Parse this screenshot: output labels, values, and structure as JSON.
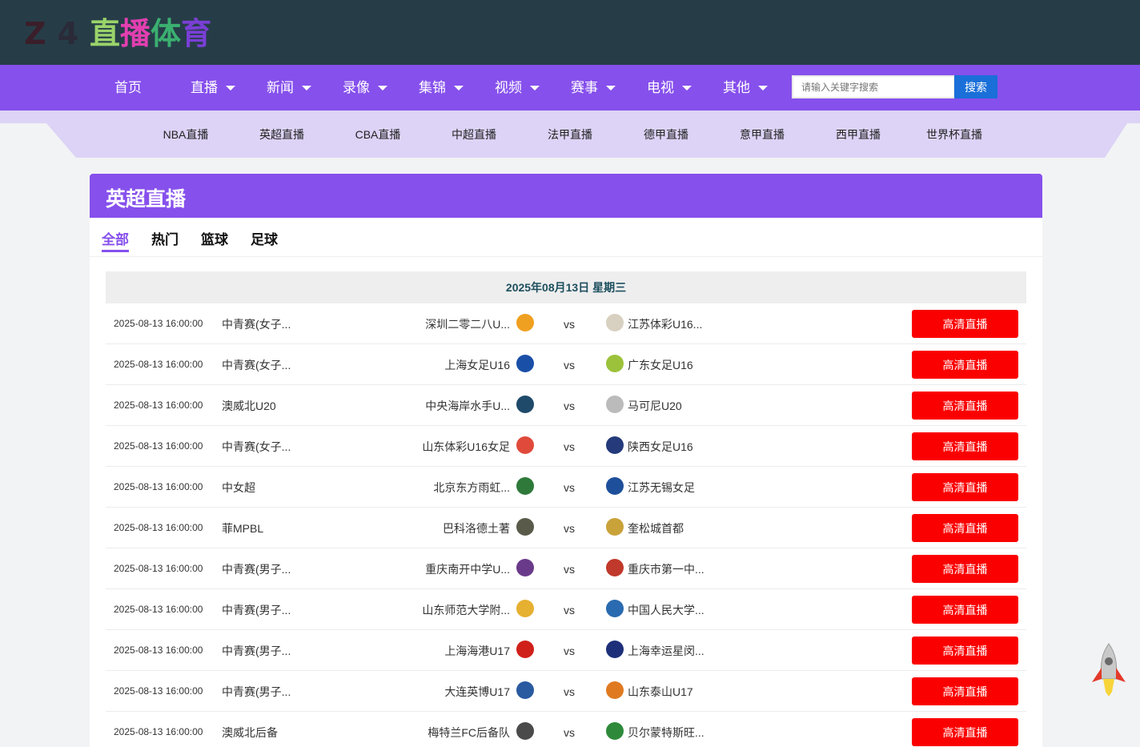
{
  "logo": {
    "chars": [
      "Z",
      "4",
      "直",
      "播",
      "体",
      "育"
    ],
    "colors": [
      "#3a1e2a",
      "#2a2a38",
      "#9ad36a",
      "#e23fb0",
      "#3bb070",
      "#7a3fd6"
    ]
  },
  "nav": {
    "items": [
      {
        "label": "首页",
        "dropdown": false
      },
      {
        "label": "直播",
        "dropdown": true
      },
      {
        "label": "新闻",
        "dropdown": true
      },
      {
        "label": "录像",
        "dropdown": true
      },
      {
        "label": "集锦",
        "dropdown": true
      },
      {
        "label": "视频",
        "dropdown": true
      },
      {
        "label": "赛事",
        "dropdown": true
      },
      {
        "label": "电视",
        "dropdown": true
      },
      {
        "label": "其他",
        "dropdown": true
      }
    ],
    "search_placeholder": "请输入关键字搜索",
    "search_button": "搜索"
  },
  "subnav": [
    "NBA直播",
    "英超直播",
    "CBA直播",
    "中超直播",
    "法甲直播",
    "德甲直播",
    "意甲直播",
    "西甲直播",
    "世界杯直播"
  ],
  "panel": {
    "title": "英超直播",
    "tabs": [
      "全部",
      "热门",
      "篮球",
      "足球"
    ],
    "active_tab": "全部",
    "date_label": "2025年08月13日 星期三"
  },
  "matches": [
    {
      "time": "2025-08-13 16:00:00",
      "league": "中青赛(女子...",
      "home": "深圳二零二八U...",
      "away": "江苏体彩U16...",
      "home_icon": "orange-flower-badge",
      "away_icon": "gray-round-badge",
      "home_color": "#f0a020",
      "away_color": "#d8d0c0",
      "button": "高清直播"
    },
    {
      "time": "2025-08-13 16:00:00",
      "league": "中青赛(女子...",
      "home": "上海女足U16",
      "away": "广东女足U16",
      "home_icon": "sfa-shield-badge",
      "away_icon": "green-round-badge",
      "home_color": "#1a4fa8",
      "away_color": "#9bc23a",
      "button": "高清直播"
    },
    {
      "time": "2025-08-13 16:00:00",
      "league": "澳威北U20",
      "home": "中央海岸水手U...",
      "away": "马可尼U20",
      "home_icon": "mariners-badge",
      "away_icon": "marconi-wordmark",
      "home_color": "#1f4a6a",
      "away_color": "#bbbbbb",
      "button": "高清直播"
    },
    {
      "time": "2025-08-13 16:00:00",
      "league": "中青赛(女子...",
      "home": "山东体彩U16女足",
      "away": "陕西女足U16",
      "home_icon": "red-shield-badge",
      "away_icon": "navy-crest-badge",
      "home_color": "#e04a3a",
      "away_color": "#243a7a",
      "button": "高清直播"
    },
    {
      "time": "2025-08-13 16:00:00",
      "league": "中女超",
      "home": "北京东方雨虹...",
      "away": "江苏无锡女足",
      "home_icon": "green-shield-badge",
      "away_icon": "blue-shield-badge",
      "home_color": "#2f7a3a",
      "away_color": "#1e4f9a",
      "button": "高清直播"
    },
    {
      "time": "2025-08-13 16:00:00",
      "league": "菲MPBL",
      "home": "巴科洛德土著",
      "away": "奎松城首都",
      "home_icon": "tank-logo",
      "away_icon": "gold-wordmark",
      "home_color": "#5a5a4a",
      "away_color": "#c9a23a",
      "button": "高清直播"
    },
    {
      "time": "2025-08-13 16:00:00",
      "league": "中青赛(男子...",
      "home": "重庆南开中学U...",
      "away": "重庆市第一中...",
      "home_icon": "purple-round-badge",
      "away_icon": "red-round-badge",
      "home_color": "#6a3a8a",
      "away_color": "#c0392b",
      "button": "高清直播"
    },
    {
      "time": "2025-08-13 16:00:00",
      "league": "中青赛(男子...",
      "home": "山东师范大学附...",
      "away": "中国人民大学...",
      "home_icon": "yellow-shield-badge",
      "away_icon": "blue-triangle-badge",
      "home_color": "#e6b030",
      "away_color": "#2a6ab0",
      "button": "高清直播"
    },
    {
      "time": "2025-08-13 16:00:00",
      "league": "中青赛(男子...",
      "home": "上海海港U17",
      "away": "上海幸运星闵...",
      "home_icon": "port-red-badge",
      "away_icon": "star-navy-badge",
      "home_color": "#d0201a",
      "away_color": "#1e2f7a",
      "button": "高清直播"
    },
    {
      "time": "2025-08-13 16:00:00",
      "league": "中青赛(男子...",
      "home": "大连英博U17",
      "away": "山东泰山U17",
      "home_icon": "yingbo-shield-badge",
      "away_icon": "taishan-badge",
      "home_color": "#2a5aa0",
      "away_color": "#e07a20",
      "button": "高清直播"
    },
    {
      "time": "2025-08-13 16:00:00",
      "league": "澳威北后备",
      "home": "梅特兰FC后备队",
      "away": "贝尔蒙特斯旺...",
      "home_icon": "maitland-badge",
      "away_icon": "green-small-badge",
      "home_color": "#4a4a4a",
      "away_color": "#2e8a3a",
      "button": "高清直播"
    }
  ]
}
